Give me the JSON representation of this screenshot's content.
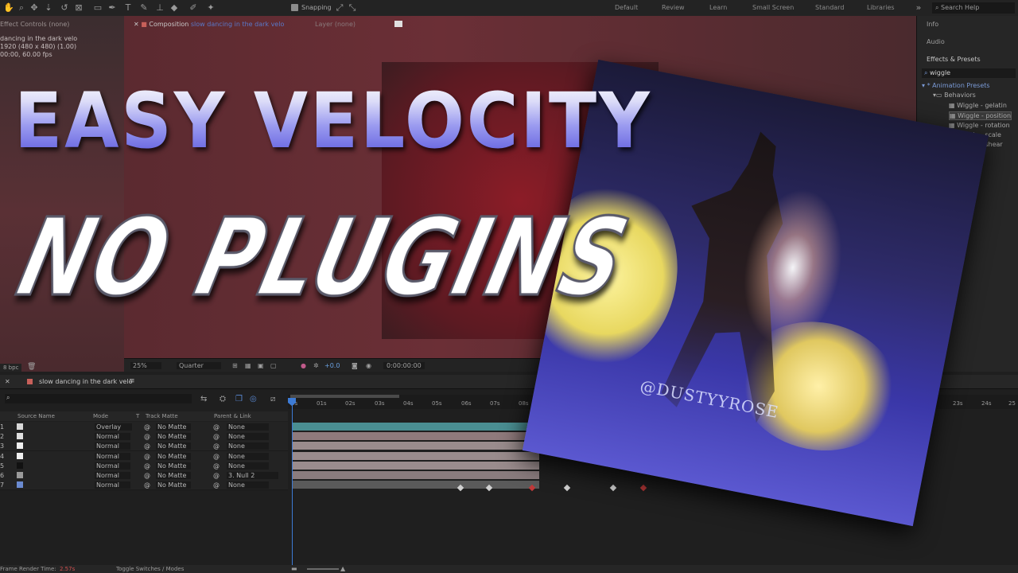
{
  "toolbar": {
    "snapping": "Snapping",
    "workspaces": [
      "Default",
      "Review",
      "Learn",
      "Small Screen",
      "Standard",
      "Libraries"
    ],
    "search_help": "Search Help"
  },
  "effect_controls": {
    "tab": "Effect Controls (none)",
    "comp_name": "dancing in the dark velo",
    "size": "1920 (480 x 480) (1.00)",
    "duration": "00:00, 60.00 fps"
  },
  "composition": {
    "tab_prefix": "Composition",
    "tab_name": "slow dancing in the dark velo",
    "layer_tab": "Layer (none)"
  },
  "comp_footer": {
    "zoom": "25%",
    "resolution": "Quarter",
    "exposure": "+0.0",
    "timecode": "0:00:00:00",
    "bpc": "8 bpc"
  },
  "right_panel": {
    "info": "Info",
    "audio": "Audio",
    "effects_presets": "Effects & Presets",
    "search": "wiggle",
    "animation_presets": "* Animation Presets",
    "behaviors": "Behaviors",
    "presets": [
      "Wiggle - gelatin",
      "Wiggle - position",
      "Wiggle - rotation",
      "Wiggle - scale",
      "Wiggle - shear"
    ],
    "selected_index": 1
  },
  "timeline": {
    "tab": "slow dancing in the dark velo",
    "columns": {
      "source_name": "Source Name",
      "mode": "Mode",
      "t": "T",
      "track_matte": "Track Matte",
      "parent": "Parent & Link"
    },
    "ticks": [
      "0s",
      "01s",
      "02s",
      "03s",
      "04s",
      "05s",
      "06s",
      "07s",
      "08s",
      "23s",
      "24s",
      "25"
    ],
    "layers": [
      {
        "num": "1",
        "mode": "Overlay",
        "matte": "No Matte",
        "parent": "None"
      },
      {
        "num": "2",
        "mode": "Normal",
        "matte": "No Matte",
        "parent": "None"
      },
      {
        "num": "3",
        "mode": "Normal",
        "matte": "No Matte",
        "parent": "None"
      },
      {
        "num": "4",
        "mode": "Normal",
        "matte": "No Matte",
        "parent": "None"
      },
      {
        "num": "5",
        "mode": "Normal",
        "matte": "No Matte",
        "parent": "None"
      },
      {
        "num": "6",
        "mode": "Normal",
        "matte": "No Matte",
        "parent": "3. Null 2"
      },
      {
        "num": "7",
        "mode": "Normal",
        "matte": "No Matte",
        "parent": "None"
      }
    ]
  },
  "status": {
    "render_label": "Frame Render Time:",
    "render_value": "2.57s",
    "toggle": "Toggle Switches / Modes"
  },
  "overlay": {
    "headline": "EASY VELOCITY",
    "subline": "NO PLUGINS",
    "watermark": "@DUSTYYROSE"
  },
  "colors": {
    "accent": "#3d7bd5",
    "comp_red": "#8c1c27",
    "headline_blue": "#5a58e0"
  }
}
